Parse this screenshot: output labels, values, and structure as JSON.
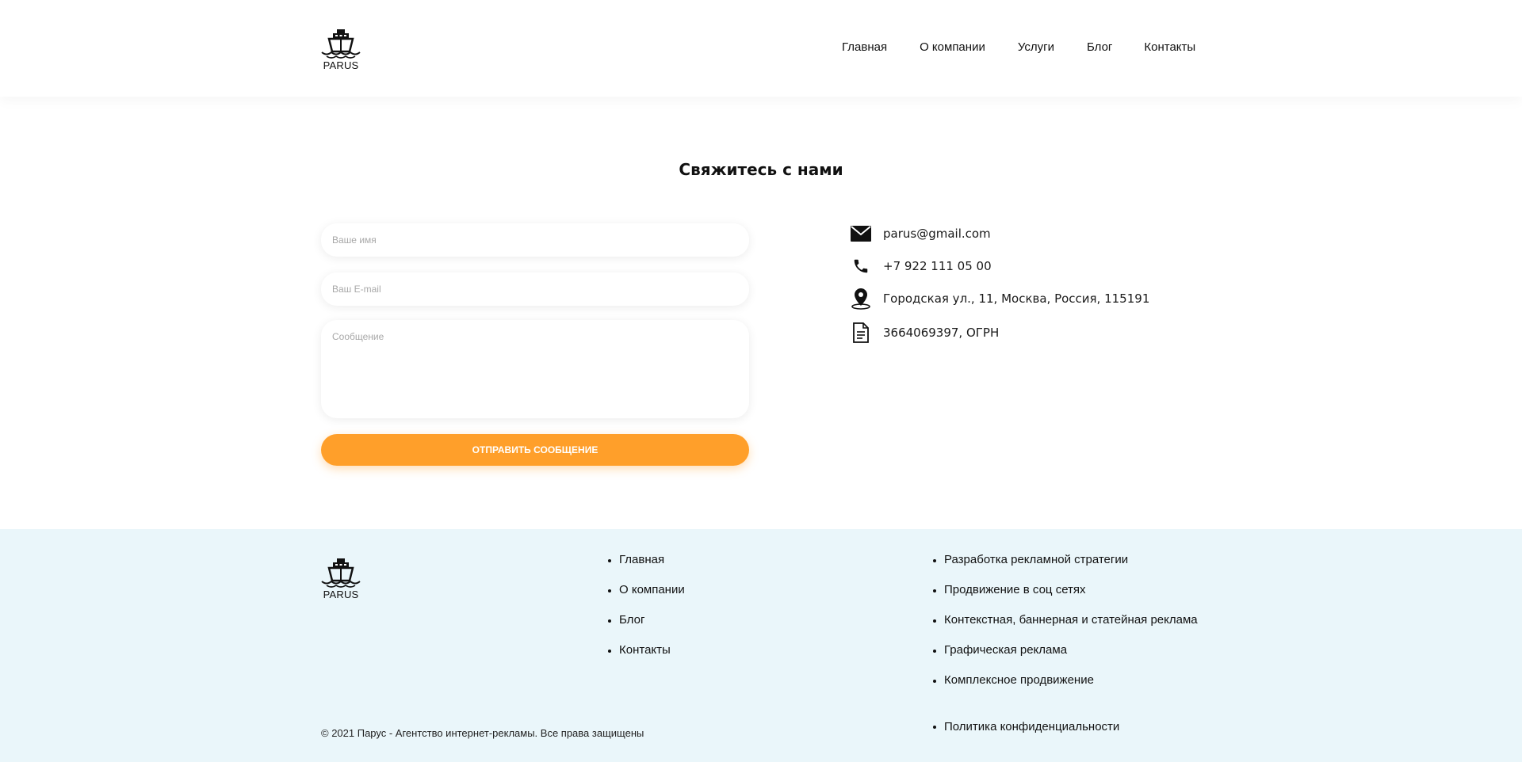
{
  "header": {
    "logo_text": "PARUS",
    "nav": [
      "Главная",
      "О компании",
      "Услуги",
      "Блог",
      "Контакты"
    ]
  },
  "contact_section": {
    "title": "Свяжитесь с нами",
    "form": {
      "name_placeholder": "Ваше имя",
      "email_placeholder": "Ваш E-mail",
      "message_placeholder": "Сообщение",
      "submit_label": "ОТПРАВИТЬ СООБЩЕНИЕ"
    },
    "info": {
      "email": "parus@gmail.com",
      "phone": "+7 922 111 05 00",
      "address": "Городская ул., 11, Москва, Россия, 115191",
      "registration": "3664069397, ОГРН"
    },
    "icons": [
      "mail-icon",
      "phone-icon",
      "location-pin-icon",
      "document-icon"
    ]
  },
  "footer": {
    "logo_text": "PARUS",
    "nav": [
      "Главная",
      "О компании",
      "Блог",
      "Контакты"
    ],
    "services": [
      "Разработка рекламной стратегии",
      "Продвижение в соц сетях",
      "Контекстная, баннерная и статейная реклама",
      "Графическая реклама",
      "Комплексное продвижение"
    ],
    "copyright": "© 2021 Парус - Агентство интернет-рекламы. Все права защищены",
    "policy": "Политика конфиденциальности"
  },
  "colors": {
    "accent": "#ff9f2a",
    "footer_bg": "#eaf6fa",
    "text": "#111111"
  }
}
